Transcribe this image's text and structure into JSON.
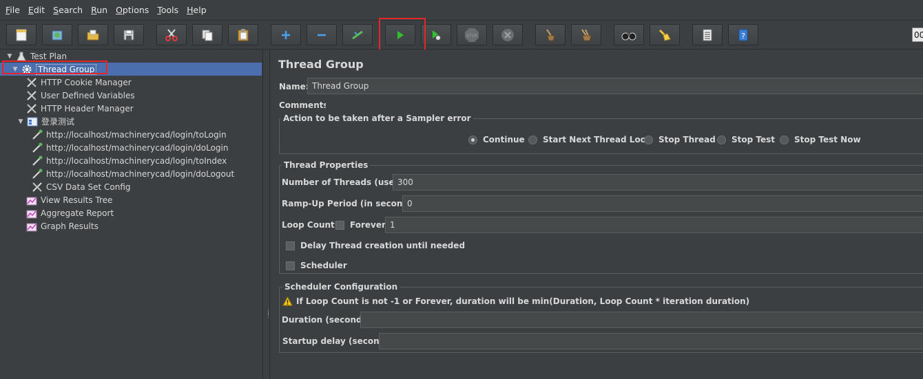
{
  "menu": {
    "items": [
      {
        "mnemonic": "F",
        "rest": "ile"
      },
      {
        "mnemonic": "E",
        "rest": "dit"
      },
      {
        "mnemonic": "S",
        "rest": "earch"
      },
      {
        "mnemonic": "R",
        "rest": "un"
      },
      {
        "mnemonic": "O",
        "rest": "ptions"
      },
      {
        "mnemonic": "T",
        "rest": "ools"
      },
      {
        "mnemonic": "H",
        "rest": "elp"
      }
    ]
  },
  "toolbar": {
    "buttons": [
      "new-icon",
      "templates-icon",
      "open-icon",
      "save-icon",
      "cut-icon",
      "copy-icon",
      "paste-icon",
      "expand-icon",
      "collapse-icon",
      "toggle-icon",
      "start-icon",
      "start-no-pauses-icon",
      "stop-icon",
      "shutdown-icon",
      "clear-icon",
      "clear-all-icon",
      "search-icon",
      "reset-search-icon",
      "function-helper-icon",
      "help-icon"
    ],
    "counter_text": "00",
    "highlight_color": "#e8262a"
  },
  "tree": {
    "test_plan": "Test Plan",
    "thread_group": "Thread Group",
    "cookie_manager": "HTTP Cookie Manager",
    "user_vars": "User Defined Variables",
    "header_manager": "HTTP Header Manager",
    "controller": "登录测试",
    "samplers": [
      "http://localhost/machinerycad/login/toLogin",
      "http://localhost/machinerycad/login/doLogin",
      "http://localhost/machinerycad/login/toIndex",
      "http://localhost/machinerycad/login/doLogout"
    ],
    "csv_config": "CSV Data Set Config",
    "results_tree": "View Results Tree",
    "aggregate_report": "Aggregate Report",
    "graph_results": "Graph Results",
    "selected_color": "#4b6eaf"
  },
  "panel": {
    "title": "Thread Group",
    "name_label": "Name:",
    "name_value": "Thread Group",
    "comments_label": "Comments:",
    "action_title": "Action to be taken after a Sampler error",
    "actions": [
      "Continue",
      "Start Next Thread Loop",
      "Stop Thread",
      "Stop Test",
      "Stop Test Now"
    ],
    "selected_action": "Continue",
    "thread_props_title": "Thread Properties",
    "threads_label": "Number of Threads (users):",
    "threads_value": "300",
    "rampup_label": "Ramp-Up Period (in seconds):",
    "rampup_value": "0",
    "loop_label": "Loop Count:",
    "forever_label": "Forever",
    "loop_value": "1",
    "delay_label": "Delay Thread creation until needed",
    "scheduler_label": "Scheduler",
    "sched_config_title": "Scheduler Configuration",
    "warning_text": "If Loop Count is not -1 or Forever, duration will be min(Duration, Loop Count * iteration duration)",
    "duration_label": "Duration (seconds)",
    "duration_value": "",
    "startup_label": "Startup delay (seconds)",
    "startup_value": ""
  }
}
